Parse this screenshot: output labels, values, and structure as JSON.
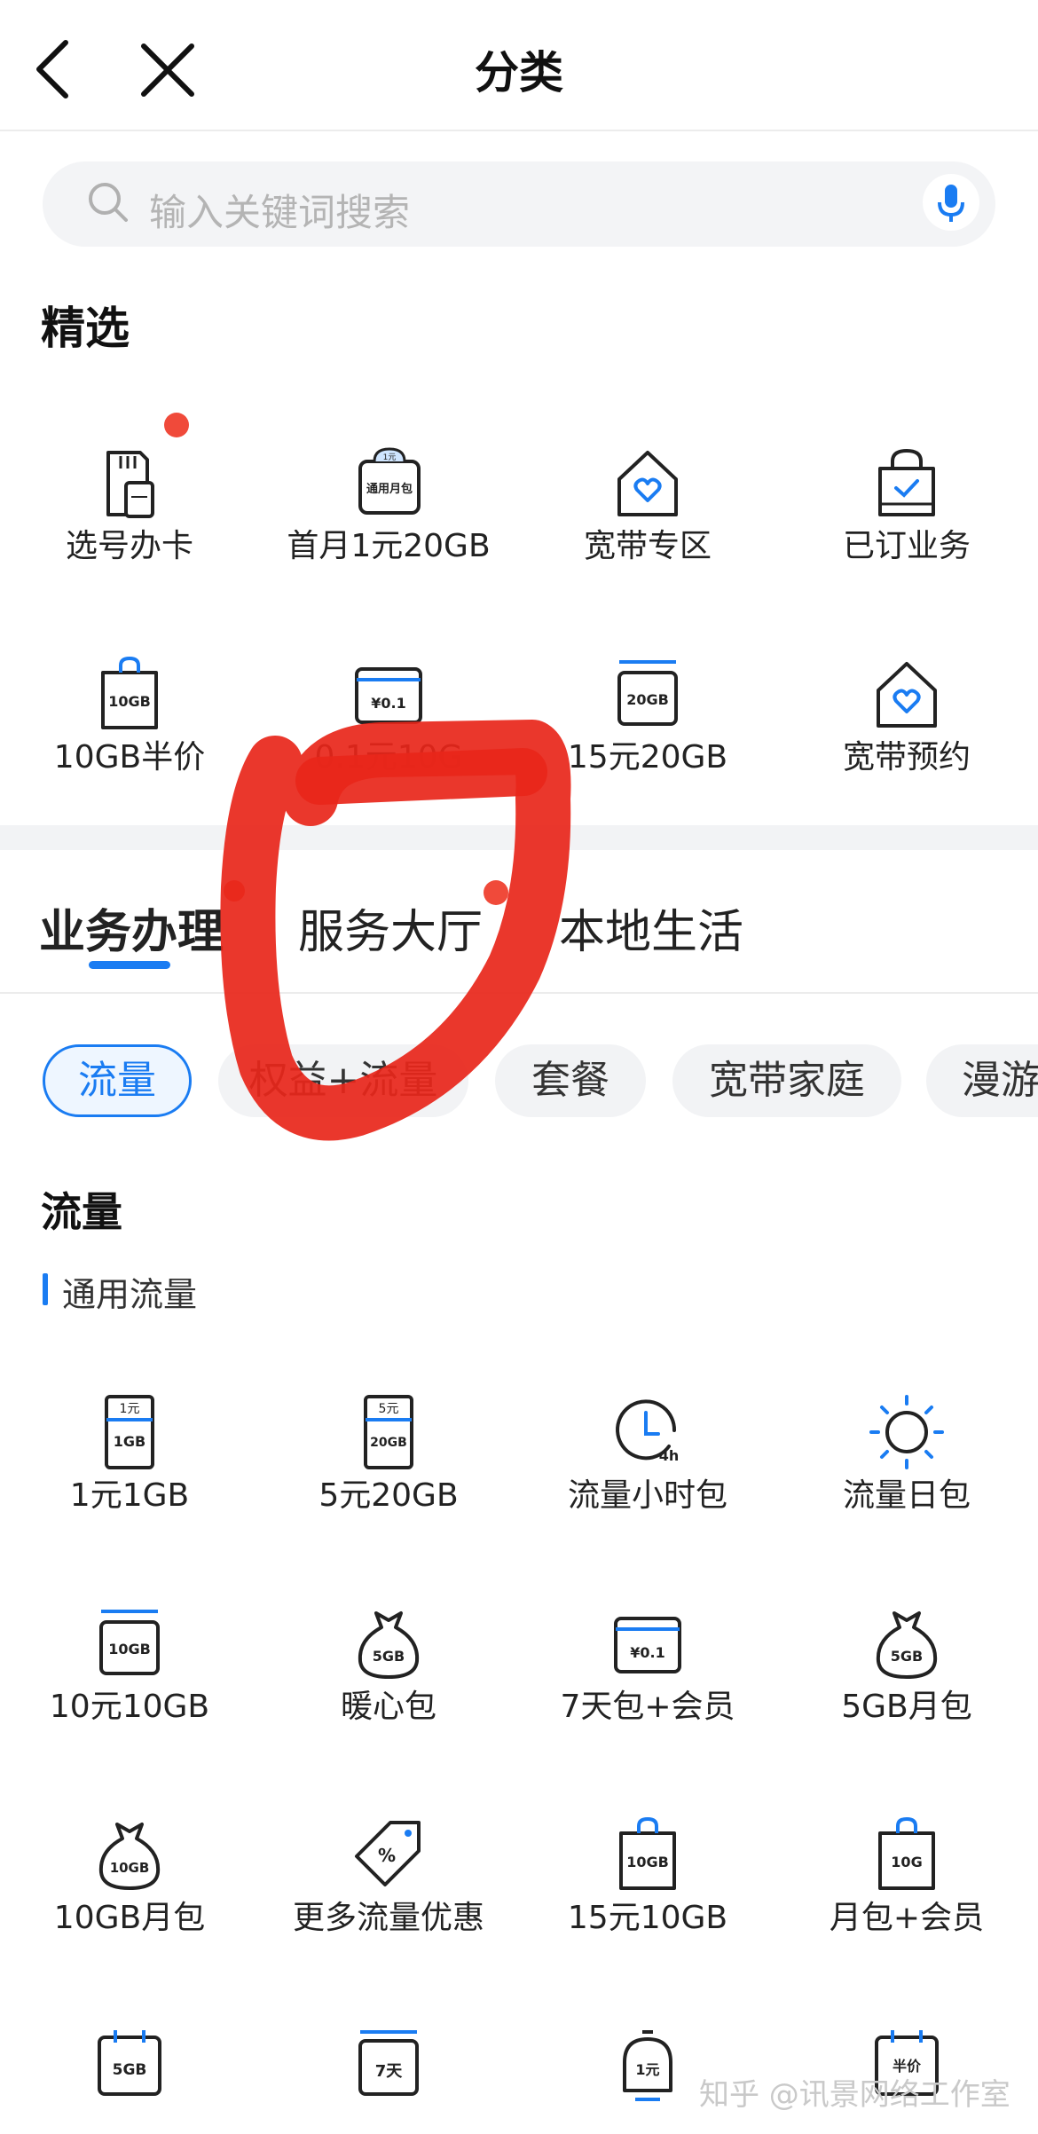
{
  "header": {
    "title": "分类"
  },
  "search": {
    "placeholder": "输入关键词搜索"
  },
  "featured": {
    "title": "精选",
    "items": [
      {
        "label": "选号办卡",
        "icon": "sim-card-icon"
      },
      {
        "label": "首月1元20GB",
        "icon": "data-package-icon",
        "icon_text": "通用月包",
        "icon_badge": "1元"
      },
      {
        "label": "宽带专区",
        "icon": "house-heart-icon"
      },
      {
        "label": "已订业务",
        "icon": "bag-check-icon"
      },
      {
        "label": "10GB半价",
        "icon": "bag-10gb-icon",
        "icon_text": "10GB"
      },
      {
        "label": "0.1元10G",
        "icon": "wallet-icon",
        "icon_text": "¥0.1"
      },
      {
        "label": "15元20GB",
        "icon": "card-20gb-icon",
        "icon_text": "20GB"
      },
      {
        "label": "宽带预约",
        "icon": "house-heart-icon"
      }
    ]
  },
  "tabs": [
    {
      "label": "业务办理",
      "active": true
    },
    {
      "label": "服务大厅",
      "active": false
    },
    {
      "label": "本地生活",
      "active": false
    }
  ],
  "chips": [
    {
      "label": "流量",
      "active": true
    },
    {
      "label": "权益+流量",
      "active": false
    },
    {
      "label": "套餐",
      "active": false
    },
    {
      "label": "宽带家庭",
      "active": false
    },
    {
      "label": "漫游",
      "active": false
    }
  ],
  "section": {
    "title": "流量",
    "subtitle": "通用流量",
    "items": [
      {
        "label": "1元1GB",
        "icon": "ticket-icon",
        "icon_top": "1元",
        "icon_text": "1GB"
      },
      {
        "label": "5元20GB",
        "icon": "ticket-icon",
        "icon_top": "5元",
        "icon_text": "20GB"
      },
      {
        "label": "流量小时包",
        "icon": "clock-icon",
        "icon_text": "4h"
      },
      {
        "label": "流量日包",
        "icon": "sun-icon"
      },
      {
        "label": "10元10GB",
        "icon": "card-10gb-icon",
        "icon_text": "10GB"
      },
      {
        "label": "暖心包",
        "icon": "money-bag-icon",
        "icon_text": "5GB"
      },
      {
        "label": "7天包+会员",
        "icon": "wallet-icon",
        "icon_text": "¥0.1"
      },
      {
        "label": "5GB月包",
        "icon": "money-bag-icon",
        "icon_text": "5GB"
      },
      {
        "label": "10GB月包",
        "icon": "money-bag-icon",
        "icon_text": "10GB"
      },
      {
        "label": "更多流量优惠",
        "icon": "discount-tag-icon",
        "icon_text": "%"
      },
      {
        "label": "15元10GB",
        "icon": "bag-10gb-icon",
        "icon_text": "10GB"
      },
      {
        "label": "月包+会员",
        "icon": "bag-10g-icon",
        "icon_text": "10G"
      },
      {
        "label": "",
        "icon": "calendar-5gb-icon",
        "icon_text": "5GB"
      },
      {
        "label": "",
        "icon": "calendar-7day-icon",
        "icon_text": "7天"
      },
      {
        "label": "",
        "icon": "bell-1yuan-icon",
        "icon_text": "1元"
      },
      {
        "label": "",
        "icon": "calendar-half-price-icon",
        "icon_text": "半价"
      }
    ]
  },
  "watermark": "知乎 @讯景网络工作室",
  "colors": {
    "accent": "#1a7cf2",
    "notification_dot": "#f04a3a",
    "annotation_scribble": "#e8261a"
  }
}
